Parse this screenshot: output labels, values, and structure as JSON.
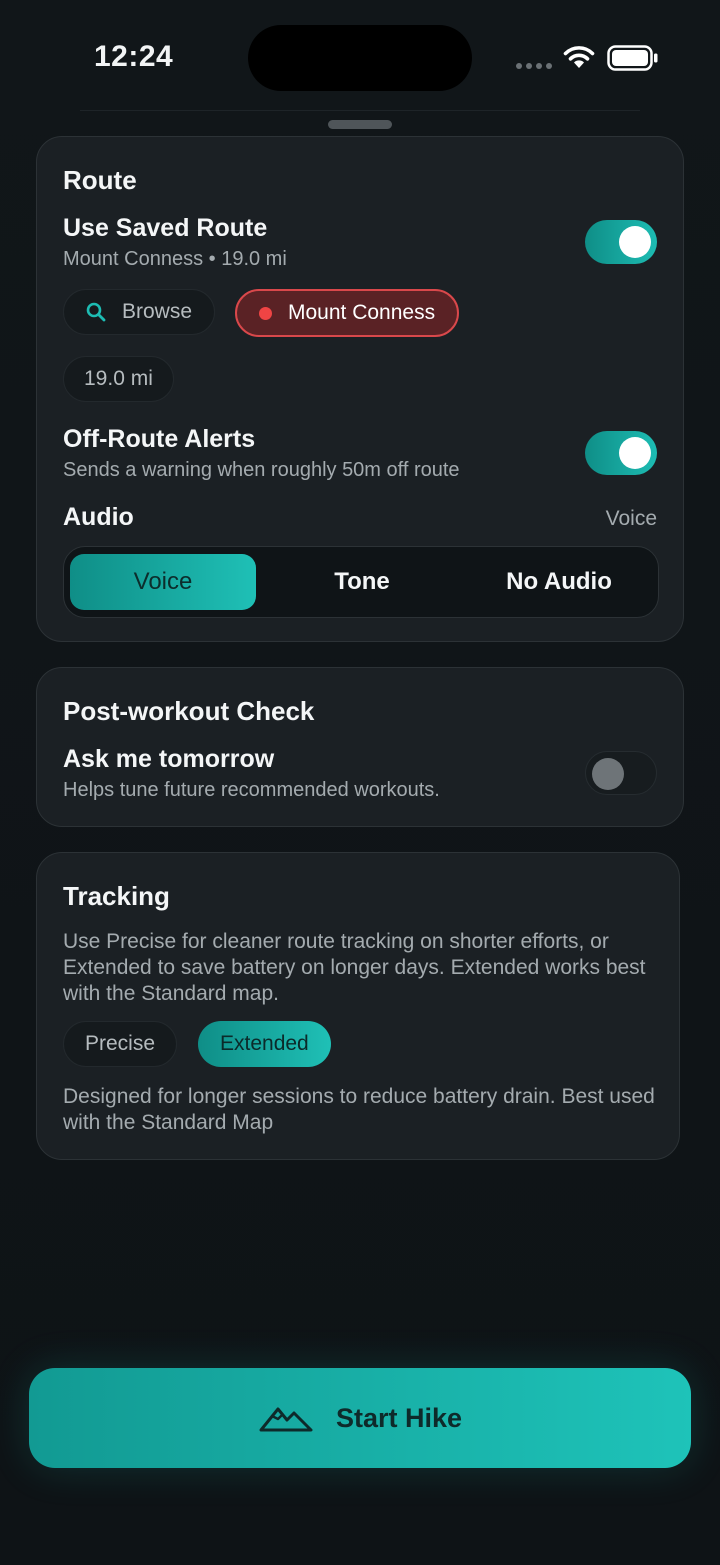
{
  "status_bar": {
    "time": "12:24"
  },
  "route_card": {
    "title": "Route",
    "use_saved_route": {
      "label": "Use Saved Route",
      "subtitle": "Mount Conness • 19.0 mi",
      "enabled": true
    },
    "chips": {
      "browse": "Browse",
      "selected_route": "Mount Conness",
      "distance": "19.0 mi"
    },
    "off_route": {
      "label": "Off-Route Alerts",
      "subtitle": "Sends a warning when roughly 50m off route",
      "enabled": true
    },
    "audio": {
      "label": "Audio",
      "current": "Voice",
      "options": [
        "Voice",
        "Tone",
        "No Audio"
      ],
      "selected": "Voice"
    }
  },
  "post_workout_card": {
    "title": "Post-workout Check",
    "ask": {
      "label": "Ask me tomorrow",
      "subtitle": "Helps tune future recommended workouts.",
      "enabled": false
    }
  },
  "tracking_card": {
    "title": "Tracking",
    "description": "Use Precise for cleaner route tracking on shorter efforts, or Extended to save battery on longer days. Extended works best with the Standard map.",
    "options": [
      "Precise",
      "Extended"
    ],
    "selected": "Extended",
    "selected_description": "Designed for longer sessions to reduce battery drain. Best used with the Standard Map"
  },
  "start_button": {
    "label": "Start Hike",
    "icon": "mountain-icon"
  },
  "colors": {
    "accent": "#1dbcb3",
    "alert": "#ef4444",
    "background": "#0f1418",
    "card": "#1b2024"
  }
}
